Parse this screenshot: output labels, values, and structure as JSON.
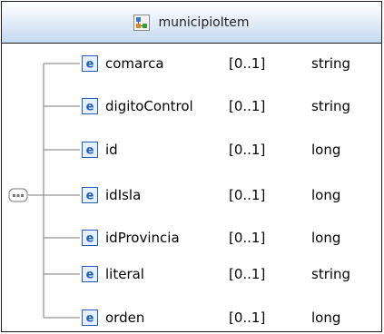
{
  "complex_type": {
    "name": "municipioItem",
    "icon": "complex-type-icon"
  },
  "compositor": {
    "icon": "sequence-compositor-icon"
  },
  "elements": [
    {
      "icon": "element-icon",
      "name": "comarca",
      "cardinality": "[0..1]",
      "type": "string"
    },
    {
      "icon": "element-icon",
      "name": "digitoControl",
      "cardinality": "[0..1]",
      "type": "string"
    },
    {
      "icon": "element-icon",
      "name": "id",
      "cardinality": "[0..1]",
      "type": "long"
    },
    {
      "icon": "element-icon",
      "name": "idIsla",
      "cardinality": "[0..1]",
      "type": "long"
    },
    {
      "icon": "element-icon",
      "name": "idProvincia",
      "cardinality": "[0..1]",
      "type": "long"
    },
    {
      "icon": "element-icon",
      "name": "literal",
      "cardinality": "[0..1]",
      "type": "string"
    },
    {
      "icon": "element-icon",
      "name": "orden",
      "cardinality": "[0..1]",
      "type": "long"
    }
  ],
  "colors": {
    "border": "#1c1c1c",
    "header_gradient_bottom": "#c4d9f0",
    "icon_blue": "#1f5fb5",
    "connector": "#7a7a7a"
  }
}
